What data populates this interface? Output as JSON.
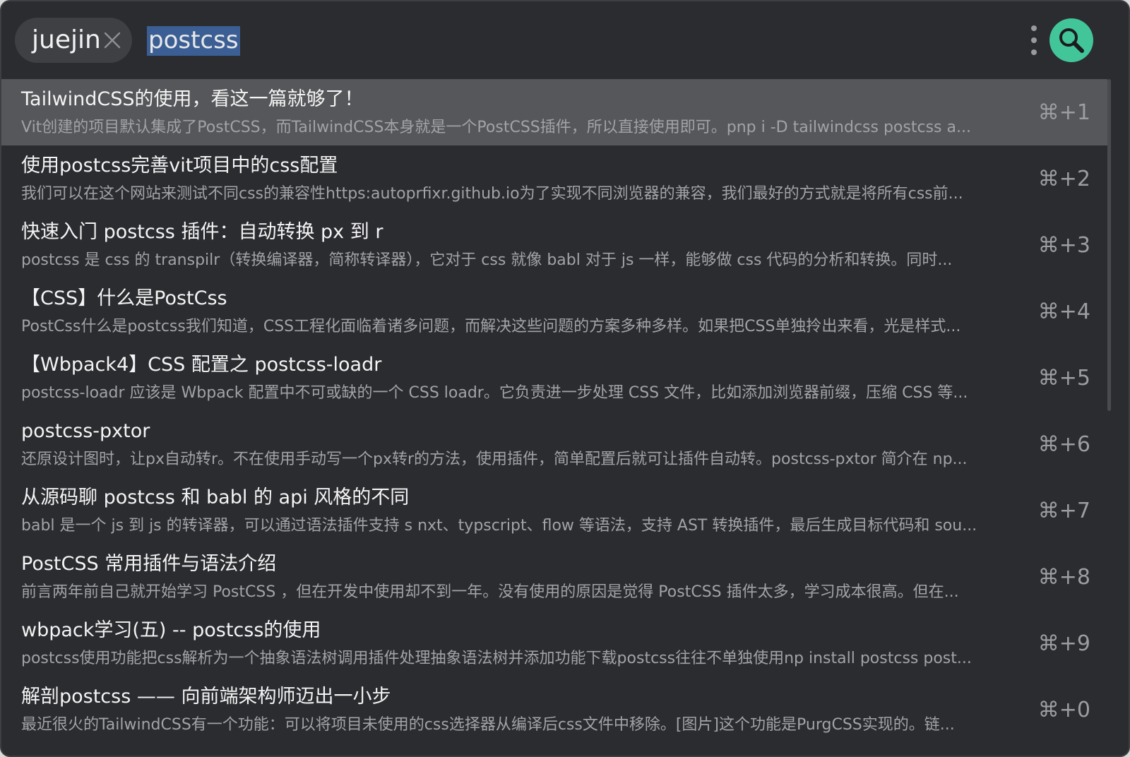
{
  "header": {
    "tag_label": "juejin",
    "query": "postcss"
  },
  "colors": {
    "background": "#2b2c30",
    "selected_row": "#56575a",
    "accent": "#43c59a",
    "selection_highlight": "#3b5f94"
  },
  "results": [
    {
      "title": "TailwindCSS的使用，看这一篇就够了！",
      "desc": "Vit创建的项目默认集成了PostCSS，而TailwindCSS本身就是一个PostCSS插件，所以直接使用即可。pnp i -D tailwindcss postcss a...",
      "shortcut": "⌘+1",
      "selected": true
    },
    {
      "title": "使用postcss完善vit项目中的css配置",
      "desc": "我们可以在这个网站来测试不同css的兼容性https:autoprfixr.github.io为了实现不同浏览器的兼容，我们最好的方式就是将所有css前...",
      "shortcut": "⌘+2"
    },
    {
      "title": "快速入门 postcss 插件：自动转换 px 到 r",
      "desc": "postcss 是 css 的 transpilr（转换编译器，简称转译器），它对于 css 就像 babl 对于 js 一样，能够做 css 代码的分析和转换。同时...",
      "shortcut": "⌘+3"
    },
    {
      "title": "【CSS】什么是PostCss",
      "desc": "PostCss什么是postcss我们知道，CSS工程化面临着诸多问题，而解决这些问题的方案多种多样。如果把CSS单独拎出来看，光是样式...",
      "shortcut": "⌘+4"
    },
    {
      "title": "【Wbpack4】CSS 配置之 postcss-loadr",
      "desc": "postcss-loadr 应该是 Wbpack 配置中不可或缺的一个 CSS loadr。它负责进一步处理 CSS 文件，比如添加浏览器前缀，压缩 CSS 等...",
      "shortcut": "⌘+5"
    },
    {
      "title": "postcss-pxtor",
      "desc": "还原设计图时，让px自动转r。不在使用手动写一个px转r的方法，使用插件，简单配置后就可让插件自动转。postcss-pxtor 简介在 np...",
      "shortcut": "⌘+6"
    },
    {
      "title": "从源码聊 postcss 和 babl 的 api 风格的不同",
      "desc": "babl 是一个 js 到 js 的转译器，可以通过语法插件支持 s nxt、typscript、flow 等语法，支持 AST 转换插件，最后生成目标代码和 sou...",
      "shortcut": "⌘+7"
    },
    {
      "title": "PostCSS 常用插件与语法介绍",
      "desc": "前言两年前自己就开始学习 PostCSS ，但在开发中使用却不到一年。没有使用的原因是觉得 PostCSS 插件太多，学习成本很高。但在...",
      "shortcut": "⌘+8"
    },
    {
      "title": "wbpack学习(五) -- postcss的使用",
      "desc": "postcss使用功能把css解析为一个抽象语法树调用插件处理抽象语法树并添加功能下载postcss往往不单独使用np install postcss post...",
      "shortcut": "⌘+9"
    },
    {
      "title": "解剖postcss —— 向前端架构师迈出一小步",
      "desc": "最近很火的TailwindCSS有一个功能：可以将项目未使用的css选择器从编译后css文件中移除。[图片]这个功能是PurgCSS实现的。链...",
      "shortcut": "⌘+0"
    }
  ]
}
